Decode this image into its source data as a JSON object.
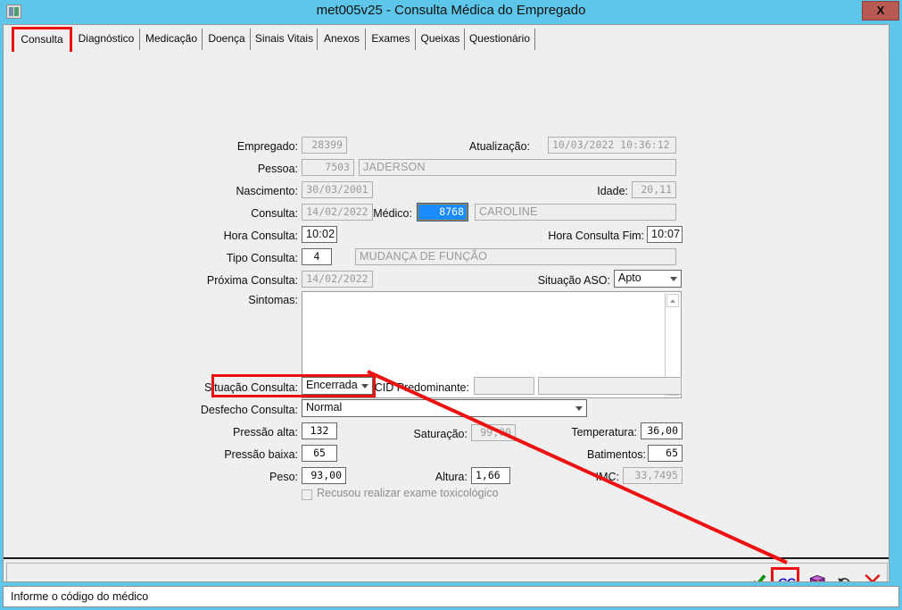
{
  "window": {
    "title": "met005v25 - Consulta Médica do Empregado",
    "close_label": "X",
    "sys_icon": "window-restore-icon",
    "titlebar_color": "#5ec6e8",
    "accent_highlight_color": "#ee1111"
  },
  "tabs": [
    {
      "label": "Consulta",
      "selected": true
    },
    {
      "label": "Diagnóstico",
      "selected": false
    },
    {
      "label": "Medicação",
      "selected": false
    },
    {
      "label": "Doença",
      "selected": false
    },
    {
      "label": "Sinais Vitais",
      "selected": false
    },
    {
      "label": "Anexos",
      "selected": false
    },
    {
      "label": "Exames",
      "selected": false
    },
    {
      "label": "Queixas",
      "selected": false
    },
    {
      "label": "Questionário",
      "selected": false
    }
  ],
  "form": {
    "empregado": {
      "label": "Empregado:",
      "value": "28399"
    },
    "atualizacao": {
      "label": "Atualização:",
      "value": "10/03/2022 10:36:12"
    },
    "pessoa": {
      "label": "Pessoa:",
      "code": "7503",
      "name": "JADERSON"
    },
    "nascimento": {
      "label": "Nascimento:",
      "value": "30/03/2001"
    },
    "idade": {
      "label": "Idade:",
      "value": "20,11"
    },
    "consulta": {
      "label": "Consulta:",
      "value": "14/02/2022"
    },
    "medico": {
      "label": "Médico:",
      "code": "8768",
      "name": "CAROLINE"
    },
    "hora_consulta": {
      "label": "Hora Consulta:",
      "value": "10:02"
    },
    "hora_consulta_fim": {
      "label": "Hora Consulta Fim:",
      "value": "10:07"
    },
    "tipo_consulta": {
      "label": "Tipo Consulta:",
      "code": "4",
      "name": "MUDANÇA DE FUNÇÃO"
    },
    "proxima_consulta": {
      "label": "Próxima Consulta:",
      "value": "14/02/2022"
    },
    "situacao_aso": {
      "label": "Situação ASO:",
      "value": "Apto"
    },
    "sintomas": {
      "label": "Sintomas:",
      "value": ""
    },
    "situacao_consulta": {
      "label": "Situação Consulta:",
      "value": "Encerrada"
    },
    "cid_predominante": {
      "label": "CID Predominante:",
      "code": "",
      "name": ""
    },
    "desfecho_consulta": {
      "label": "Desfecho Consulta:",
      "value": "Normal"
    },
    "pressao_alta": {
      "label": "Pressão alta:",
      "value": "132"
    },
    "saturacao": {
      "label": "Saturação:",
      "value": "99,00"
    },
    "temperatura": {
      "label": "Temperatura:",
      "value": "36,00"
    },
    "pressao_baixa": {
      "label": "Pressão baixa:",
      "value": "65"
    },
    "batimentos": {
      "label": "Batimentos:",
      "value": "65"
    },
    "peso": {
      "label": "Peso:",
      "value": "93,00"
    },
    "altura": {
      "label": "Altura:",
      "value": "1,66"
    },
    "imc": {
      "label": "IMC:",
      "value": "33,7495"
    },
    "recusou_toxicologico": {
      "label": "Recusou realizar exame toxicológico",
      "checked": false
    }
  },
  "toolbar": {
    "confirm": {
      "name": "check-icon",
      "title": "Confirmar"
    },
    "cgi": {
      "name": "cgi-text-icon",
      "label": "CGi"
    },
    "book": {
      "name": "book-icon",
      "title": "Ajuda"
    },
    "undo": {
      "name": "undo-arrow-icon",
      "title": "Desfazer"
    },
    "cancel": {
      "name": "close-x-icon",
      "title": "Cancelar"
    }
  },
  "statusbar": {
    "message": "Informe o código do médico"
  }
}
